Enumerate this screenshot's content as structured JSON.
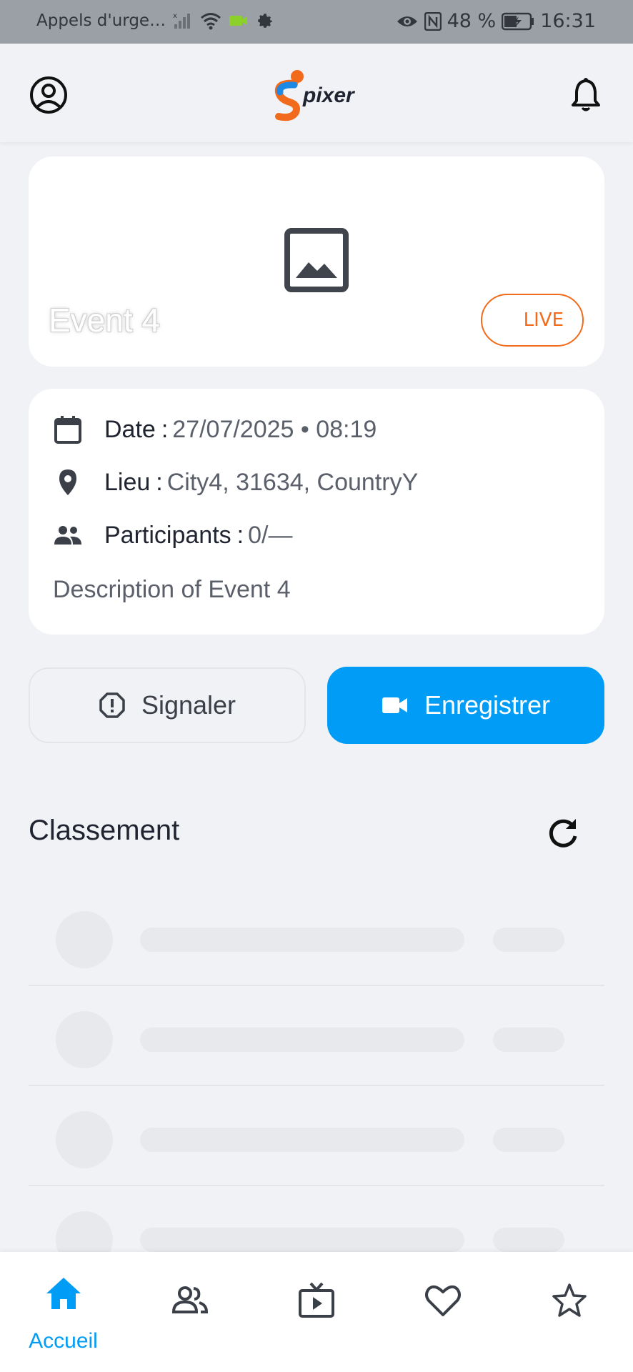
{
  "status_bar": {
    "carrier_text": "Appels d'urge…",
    "battery_percent": "48 %",
    "time": "16:31"
  },
  "header": {
    "logo_text": "pixer"
  },
  "event": {
    "title": "Event 4",
    "live_label": "LIVE",
    "date_label": "Date",
    "date_value": "27/07/2025 • 08:19",
    "location_label": "Lieu",
    "location_value": "City4, 31634, CountryY",
    "participants_label": "Participants",
    "participants_value": "0/—",
    "description": "Description of Event 4",
    "separator": ":"
  },
  "actions": {
    "report_label": "Signaler",
    "record_label": "Enregistrer"
  },
  "ranking": {
    "title": "Classement"
  },
  "bottom_nav": {
    "items": [
      {
        "icon": "home-icon",
        "label": "Accueil",
        "active": true
      },
      {
        "icon": "people-icon",
        "label": ""
      },
      {
        "icon": "tv-play-icon",
        "label": ""
      },
      {
        "icon": "heart-icon",
        "label": ""
      },
      {
        "icon": "star-icon",
        "label": ""
      }
    ]
  },
  "colors": {
    "accent": "#009cf5",
    "live": "#f26a1b",
    "logo_orange": "#f26a1b",
    "logo_blue": "#1e88e5"
  }
}
